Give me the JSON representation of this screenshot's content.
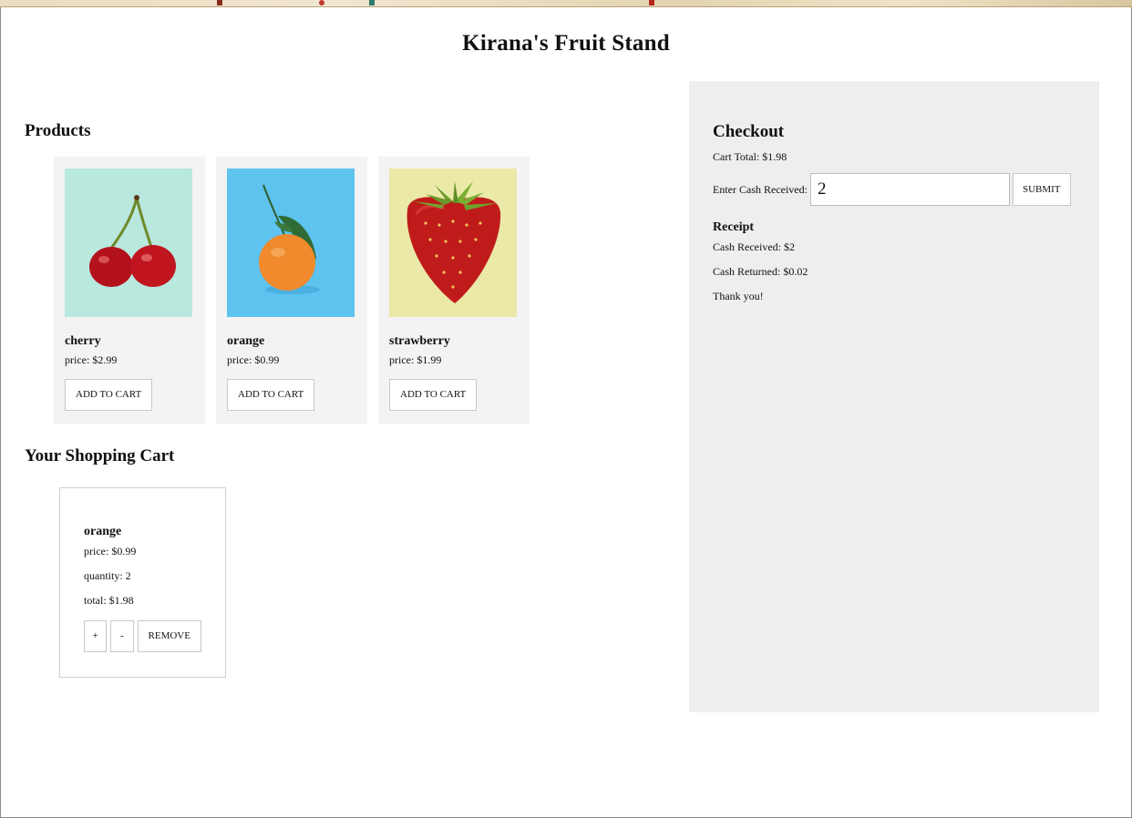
{
  "store": {
    "title": "Kirana's Fruit Stand"
  },
  "products": {
    "heading": "Products",
    "items": [
      {
        "name": "cherry",
        "price": "price: $2.99",
        "button": "ADD TO CART",
        "image_bg": "#b9e8df"
      },
      {
        "name": "orange",
        "price": "price: $0.99",
        "button": "ADD TO CART",
        "image_bg": "#5ec3ef"
      },
      {
        "name": "strawberry",
        "price": "price: $1.99",
        "button": "ADD TO CART",
        "image_bg": "#ebe9a8"
      }
    ]
  },
  "cart": {
    "heading": "Your Shopping Cart",
    "items": [
      {
        "name": "orange",
        "price": "price: $0.99",
        "quantity": "quantity: 2",
        "total": "total: $1.98",
        "plus": "+",
        "minus": "-",
        "remove": "REMOVE"
      }
    ]
  },
  "checkout": {
    "heading": "Checkout",
    "cart_total": "Cart Total: $1.98",
    "cash_label": "Enter Cash Received:",
    "cash_value": "2",
    "submit": "SUBMIT",
    "receipt": {
      "heading": "Receipt",
      "cash_received": "Cash Received: $2",
      "cash_returned": "Cash Returned: $0.02",
      "thanks": "Thank you!"
    }
  },
  "colors": {
    "product_card_bg": "#f3f3f3",
    "checkout_panel_bg": "#eeeeee"
  }
}
